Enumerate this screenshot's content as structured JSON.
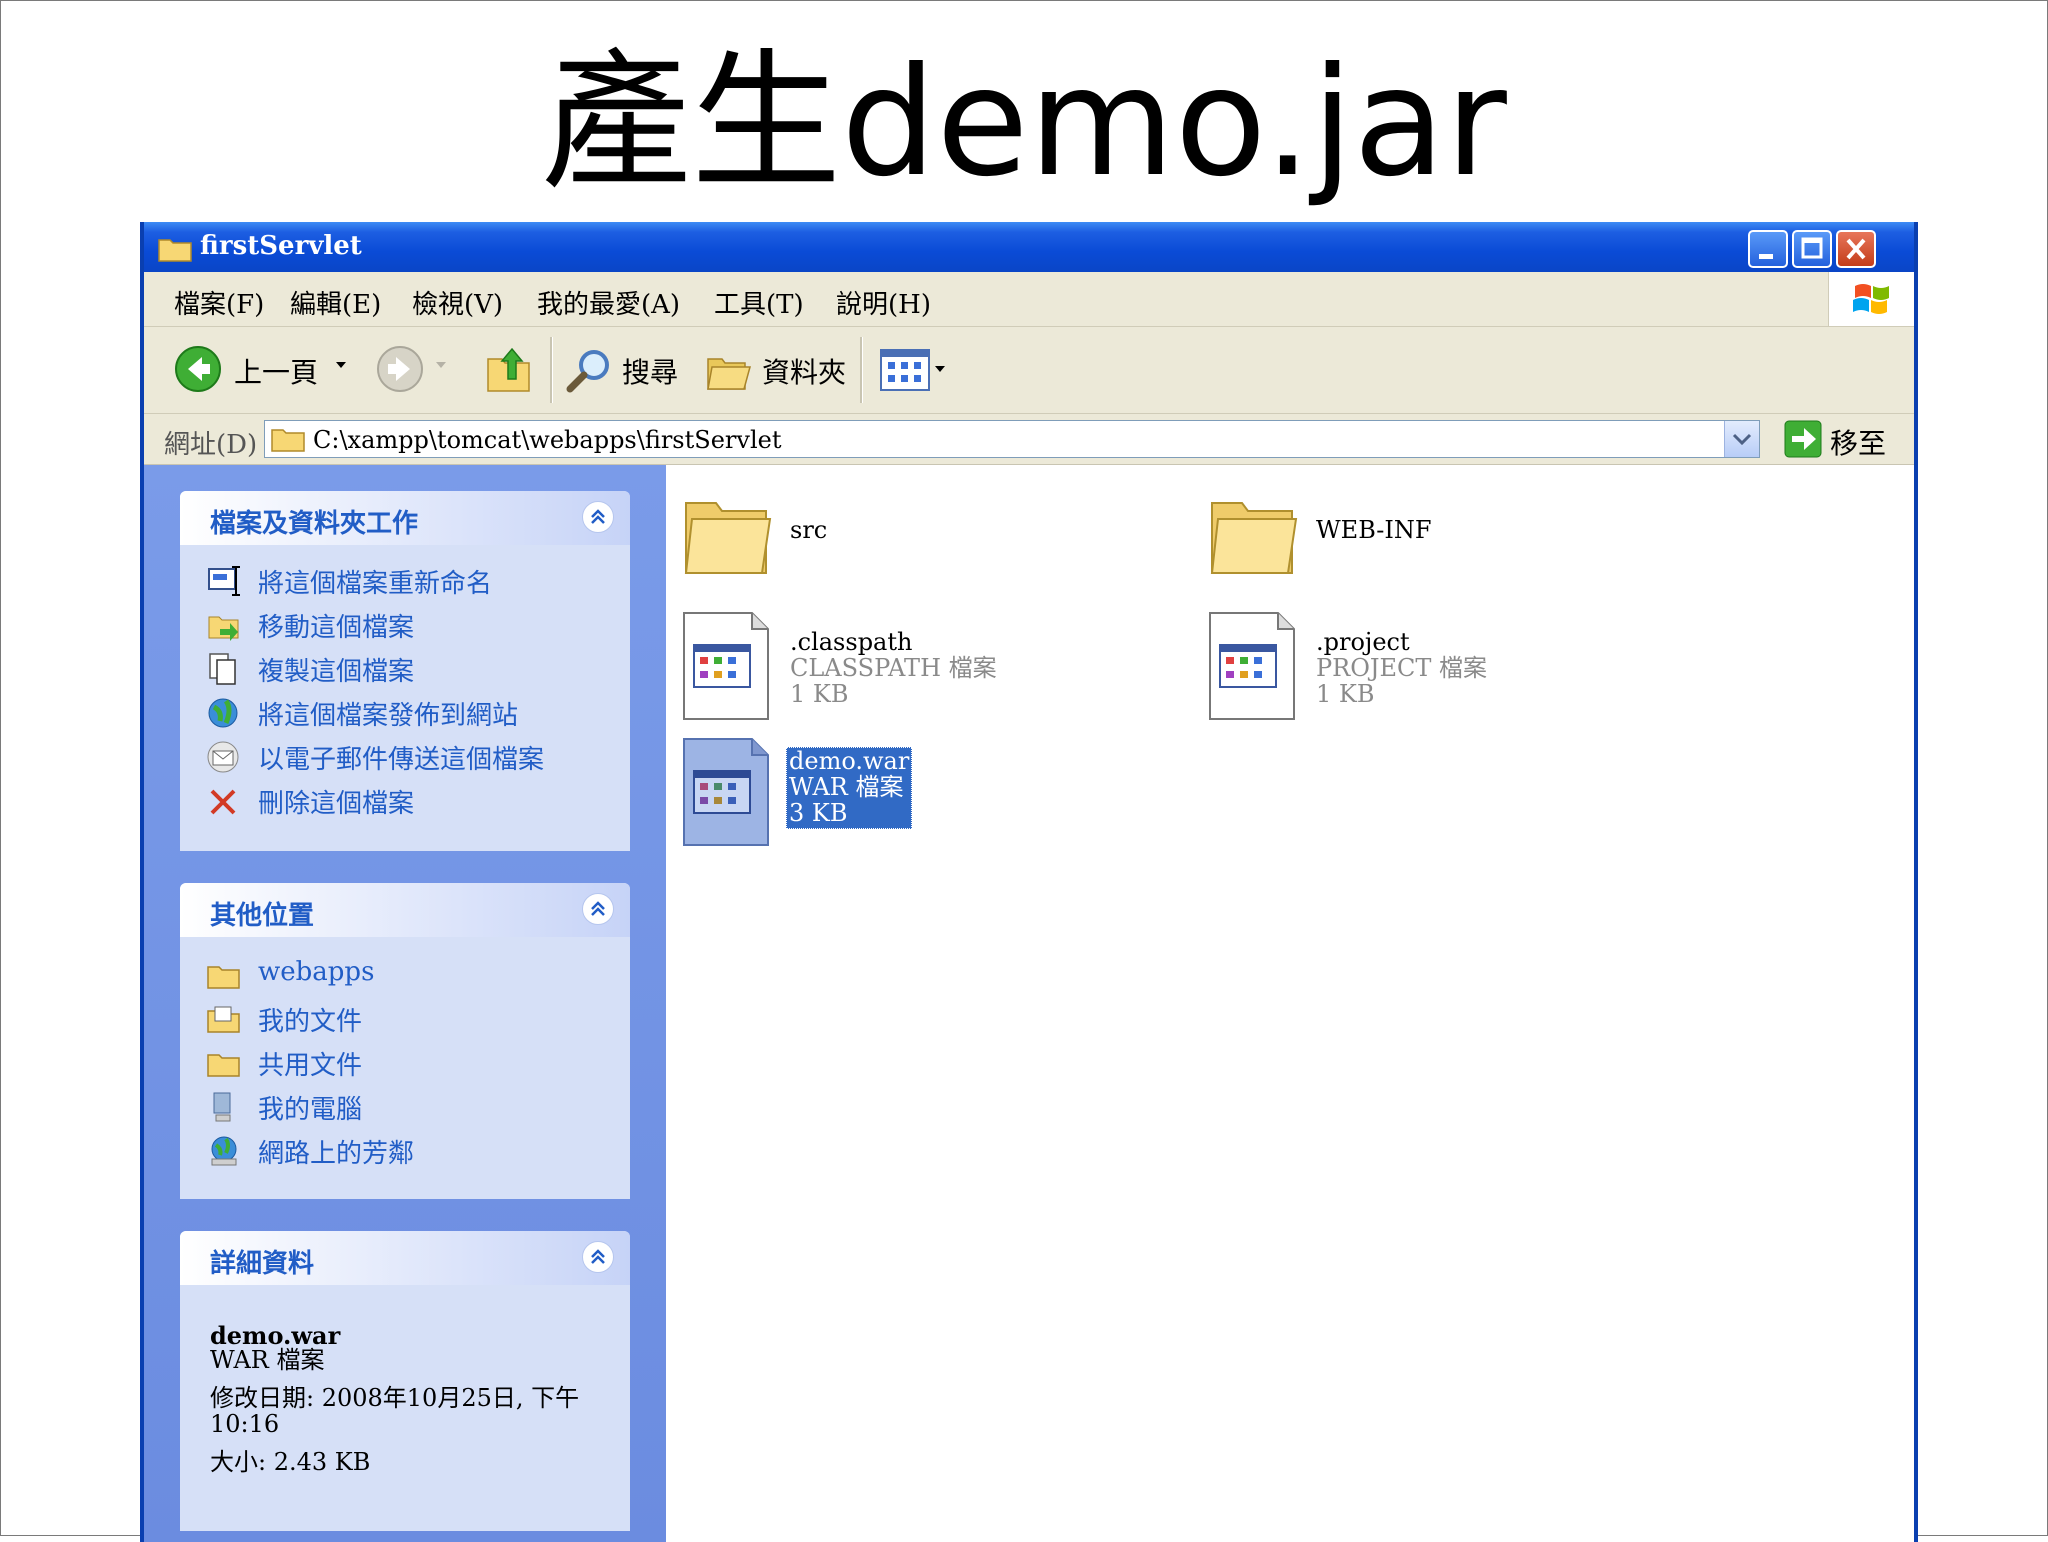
{
  "slide": {
    "title": "產生demo.jar"
  },
  "window": {
    "title": "firstServlet",
    "menu": [
      "檔案(F)",
      "編輯(E)",
      "檢視(V)",
      "我的最愛(A)",
      "工具(T)",
      "說明(H)"
    ],
    "toolbar": {
      "back": "上一頁",
      "search": "搜尋",
      "folders": "資料夾"
    },
    "address": {
      "label": "網址(D)",
      "path": "C:\\xampp\\tomcat\\webapps\\firstServlet",
      "go": "移至"
    }
  },
  "sidebar": {
    "file_tasks": {
      "title": "檔案及資料夾工作",
      "items": [
        "將這個檔案重新命名",
        "移動這個檔案",
        "複製這個檔案",
        "將這個檔案發佈到網站",
        "以電子郵件傳送這個檔案",
        "刪除這個檔案"
      ]
    },
    "other_places": {
      "title": "其他位置",
      "items": [
        "webapps",
        "我的文件",
        "共用文件",
        "我的電腦",
        "網路上的芳鄰"
      ]
    },
    "details": {
      "title": "詳細資料",
      "name": "demo.war",
      "type": "WAR 檔案",
      "modified": "修改日期: 2008年10月25日, 下午",
      "modified_time": "10:16",
      "size": "大小: 2.43 KB"
    }
  },
  "files": [
    {
      "name": "src"
    },
    {
      "name": "WEB-INF"
    },
    {
      "name": ".classpath",
      "type": "CLASSPATH 檔案",
      "size": "1 KB"
    },
    {
      "name": ".project",
      "type": "PROJECT 檔案",
      "size": "1 KB"
    },
    {
      "name": "demo.war",
      "type": "WAR 檔案",
      "size": "3 KB",
      "selected": true
    }
  ],
  "colors": {
    "titlebar": "#0a4bd6",
    "selection": "#316ac5",
    "task_link": "#215dc6",
    "sidebar_bg": "#7a9be9"
  }
}
